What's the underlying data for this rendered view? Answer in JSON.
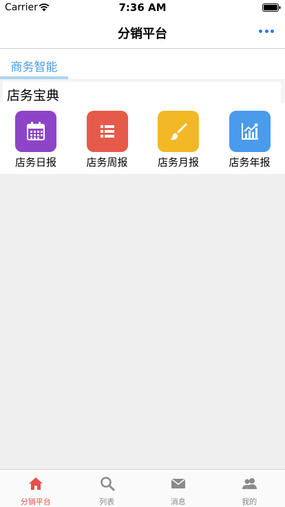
{
  "status_bar": {
    "carrier": "Carrier",
    "time": "7:36 AM"
  },
  "nav": {
    "title": "分销平台"
  },
  "tabs": [
    {
      "label": "商务智能",
      "active": true
    }
  ],
  "section": {
    "title": "店务宝典"
  },
  "grid": [
    {
      "label": "店务日报",
      "icon": "calendar-icon",
      "color": "#8e44c7"
    },
    {
      "label": "店务周报",
      "icon": "list-icon",
      "color": "#e65a4a"
    },
    {
      "label": "店务月报",
      "icon": "brush-icon",
      "color": "#f2b826"
    },
    {
      "label": "店务年报",
      "icon": "chart-icon",
      "color": "#4a9bec"
    }
  ],
  "tab_bar": [
    {
      "label": "分销平台",
      "icon": "home-icon",
      "active": true
    },
    {
      "label": "列表",
      "icon": "search-icon",
      "active": false
    },
    {
      "label": "消息",
      "icon": "mail-icon",
      "active": false
    },
    {
      "label": "我的",
      "icon": "users-icon",
      "active": false
    }
  ],
  "colors": {
    "accent": "#4a9be0",
    "active_tab": "#e8504a",
    "inactive_tab": "#8a8a8a"
  }
}
